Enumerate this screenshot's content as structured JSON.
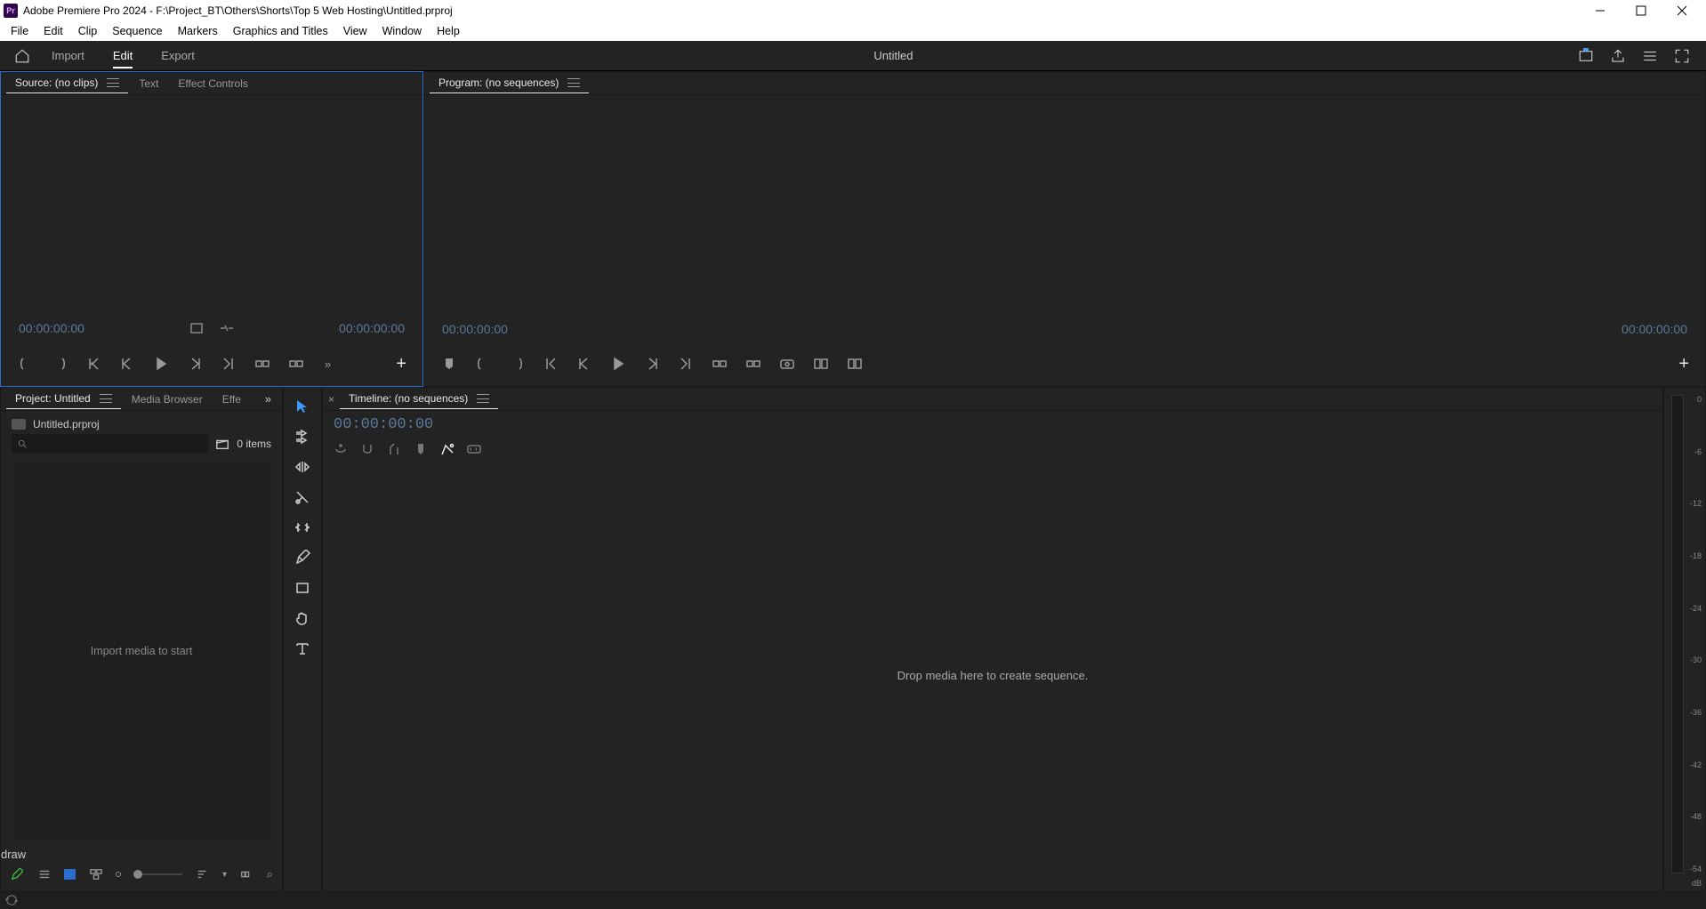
{
  "titlebar": {
    "app_icon": "Pr",
    "title": "Adobe Premiere Pro 2024 - F:\\Project_BT\\Others\\Shorts\\Top 5 Web Hosting\\Untitled.prproj"
  },
  "menubar": [
    "File",
    "Edit",
    "Clip",
    "Sequence",
    "Markers",
    "Graphics and Titles",
    "View",
    "Window",
    "Help"
  ],
  "modebar": {
    "tabs": [
      {
        "label": "Import",
        "active": false
      },
      {
        "label": "Edit",
        "active": true
      },
      {
        "label": "Export",
        "active": false
      }
    ],
    "center_title": "Untitled"
  },
  "source_panel": {
    "tabs": [
      {
        "label": "Source: (no clips)",
        "active": true,
        "menu": true
      },
      {
        "label": "Text",
        "active": false
      },
      {
        "label": "Effect Controls",
        "active": false
      }
    ],
    "tc_left": "00:00:00:00",
    "tc_right": "00:00:00:00"
  },
  "program_panel": {
    "tab_label": "Program: (no sequences)",
    "tc_left": "00:00:00:00",
    "tc_right": "00:00:00:00"
  },
  "project_panel": {
    "tabs": [
      {
        "label": "Project: Untitled",
        "active": true,
        "menu": true
      },
      {
        "label": "Media Browser",
        "active": false
      },
      {
        "label": "Effe",
        "active": false
      }
    ],
    "file_name": "Untitled.prproj",
    "item_count": "0 items",
    "drop_hint": "Import media to start"
  },
  "timeline_panel": {
    "tab_label": "Timeline: (no sequences)",
    "tc": "00:00:00:00",
    "drop_hint": "Drop media here to create sequence."
  },
  "audio_meter": {
    "ticks": [
      "0",
      "-6",
      "-12",
      "-18",
      "-24",
      "-30",
      "-36",
      "-42",
      "-48",
      "-54"
    ],
    "unit": "dB"
  },
  "tools": [
    {
      "name": "selection-tool",
      "active": true
    },
    {
      "name": "track-select-tool"
    },
    {
      "name": "ripple-edit-tool"
    },
    {
      "name": "razor-tool"
    },
    {
      "name": "slip-tool"
    },
    {
      "name": "pen-tool"
    },
    {
      "name": "rectangle-tool"
    },
    {
      "name": "hand-tool"
    },
    {
      "name": "type-tool"
    }
  ]
}
